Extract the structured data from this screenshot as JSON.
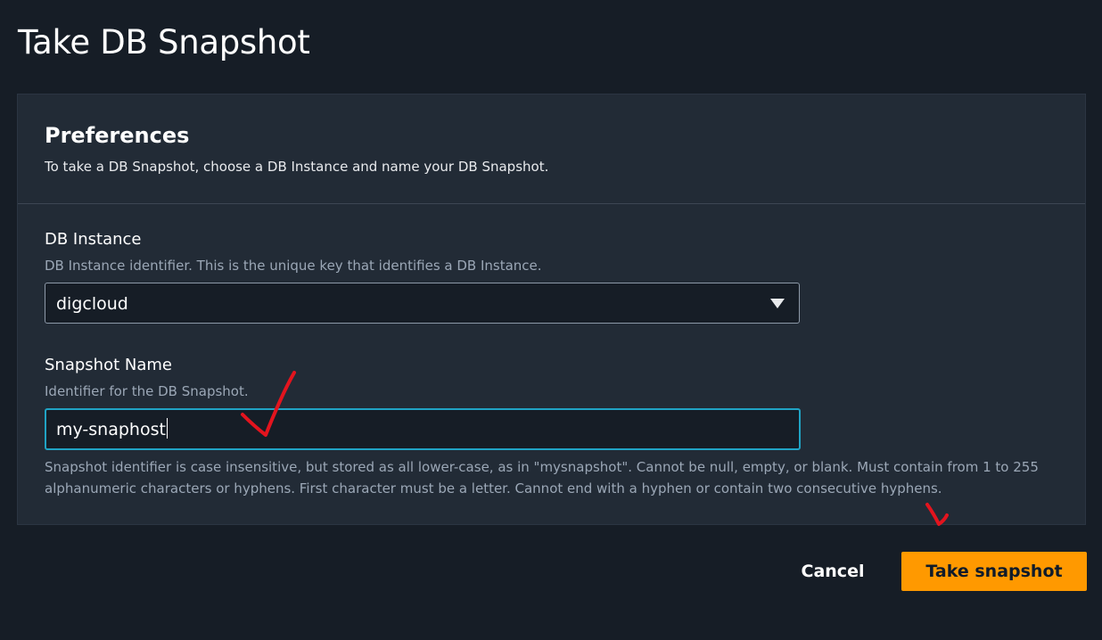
{
  "page": {
    "title": "Take DB Snapshot"
  },
  "preferences": {
    "title": "Preferences",
    "description": "To take a DB Snapshot, choose a DB Instance and name your DB Snapshot."
  },
  "db_instance": {
    "label": "DB Instance",
    "description": "DB Instance identifier. This is the unique key that identifies a DB Instance.",
    "selected_value": "digcloud",
    "caret_icon": "caret-down-icon"
  },
  "snapshot_name": {
    "label": "Snapshot Name",
    "description": "Identifier for the DB Snapshot.",
    "value": "my-snaphost",
    "constraint": "Snapshot identifier is case insensitive, but stored as all lower-case, as in \"mysnapshot\". Cannot be null, empty, or blank. Must contain from 1 to 255 alphanumeric characters or hyphens. First character must be a letter. Cannot end with a hyphen or contain two consecutive hyphens."
  },
  "actions": {
    "cancel_label": "Cancel",
    "submit_label": "Take snapshot"
  },
  "colors": {
    "background": "#161d26",
    "panel": "#222b36",
    "primary_button": "#ff9900",
    "input_focus_border": "#20a3c4",
    "annotation_marks": "#e3141e"
  }
}
